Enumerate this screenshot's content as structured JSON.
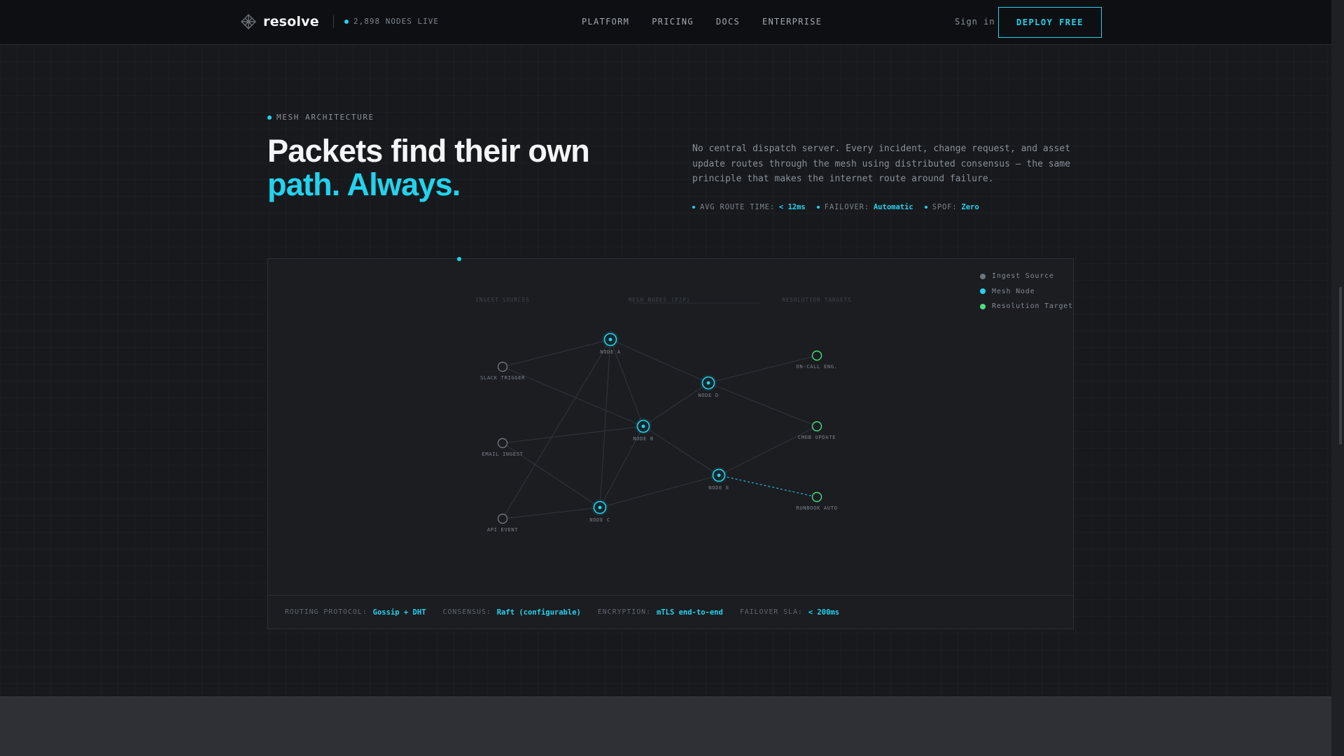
{
  "nav": {
    "brand": "resolve",
    "live_status": "2,898 NODES LIVE",
    "links": [
      "PLATFORM",
      "PRICING",
      "DOCS",
      "ENTERPRISE"
    ],
    "signin": "Sign in",
    "cta": "DEPLOY FREE"
  },
  "hero": {
    "eyebrow": "MESH ARCHITECTURE",
    "headline_line1": "Packets find their own",
    "headline_line2": "path. Always.",
    "description": "No central dispatch server. Every incident, change request, and asset update routes through the mesh using distributed consensus — the same principle that makes the internet route around failure.",
    "stats": [
      {
        "label": "AVG ROUTE TIME:",
        "value": "< 12ms"
      },
      {
        "label": "FAILOVER:",
        "value": "Automatic"
      },
      {
        "label": "SPOF:",
        "value": "Zero"
      }
    ]
  },
  "diagram": {
    "column_labels": [
      "INGEST SOURCES",
      "MESH NODES (P2P)",
      "RESOLUTION TARGETS"
    ],
    "legend": [
      {
        "label": "Ingest Source",
        "color": "#6f757c"
      },
      {
        "label": "Mesh Node",
        "color": "#22d3ee"
      },
      {
        "label": "Resolution Target",
        "color": "#4ade80"
      }
    ],
    "nodes": [
      {
        "id": "slack",
        "label": "SLACK TRIGGER",
        "kind": "ingest"
      },
      {
        "id": "email",
        "label": "EMAIL INGEST",
        "kind": "ingest"
      },
      {
        "id": "api",
        "label": "API EVENT",
        "kind": "ingest"
      },
      {
        "id": "A",
        "label": "NODE A",
        "kind": "mesh"
      },
      {
        "id": "B",
        "label": "NODE B",
        "kind": "mesh"
      },
      {
        "id": "C",
        "label": "NODE C",
        "kind": "mesh"
      },
      {
        "id": "D",
        "label": "NODE D",
        "kind": "mesh"
      },
      {
        "id": "E",
        "label": "NODE E",
        "kind": "mesh"
      },
      {
        "id": "oncall",
        "label": "ON-CALL ENG.",
        "kind": "target"
      },
      {
        "id": "cmdb",
        "label": "CMDB UPDATE",
        "kind": "target"
      },
      {
        "id": "runbook",
        "label": "RUNBOOK AUTO",
        "kind": "target"
      }
    ],
    "edges": [
      [
        "slack",
        "A"
      ],
      [
        "slack",
        "B"
      ],
      [
        "email",
        "B"
      ],
      [
        "api",
        "C"
      ],
      [
        "api",
        "A"
      ],
      [
        "A",
        "B"
      ],
      [
        "A",
        "D"
      ],
      [
        "A",
        "C"
      ],
      [
        "B",
        "D"
      ],
      [
        "B",
        "E"
      ],
      [
        "B",
        "C"
      ],
      [
        "C",
        "E"
      ],
      [
        "D",
        "oncall"
      ],
      [
        "D",
        "cmdb"
      ],
      [
        "E",
        "cmdb"
      ],
      [
        "email",
        "C"
      ]
    ],
    "active_edge": [
      "E",
      "runbook"
    ],
    "colors": {
      "ingest": "#6f757c",
      "mesh": "#22d3ee",
      "target": "#4ade80"
    }
  },
  "footer": [
    {
      "label": "ROUTING PROTOCOL:",
      "value": "Gossip + DHT"
    },
    {
      "label": "CONSENSUS:",
      "value": "Raft (configurable)"
    },
    {
      "label": "ENCRYPTION:",
      "value": "mTLS end-to-end"
    },
    {
      "label": "FAILOVER SLA:",
      "value": "< 200ms"
    }
  ]
}
